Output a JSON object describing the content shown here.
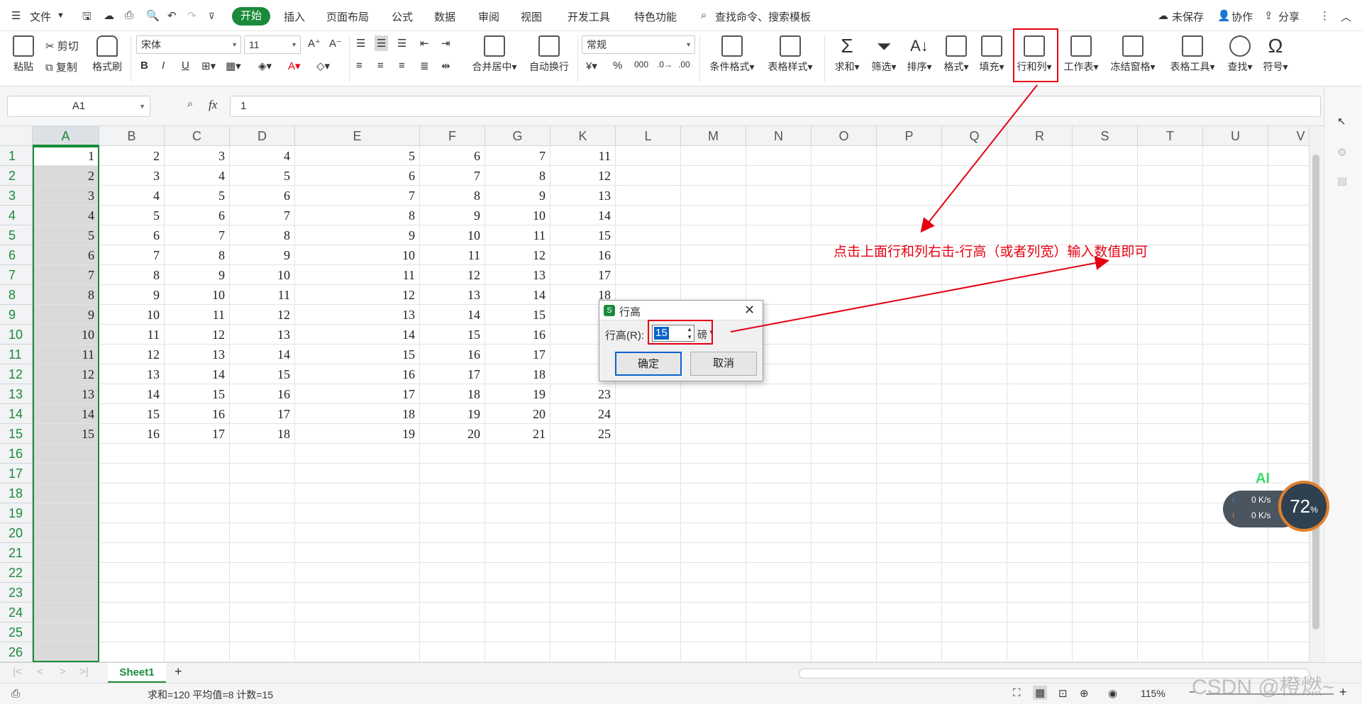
{
  "menubar": {
    "file": "文件",
    "tabs": [
      "开始",
      "插入",
      "页面布局",
      "公式",
      "数据",
      "审阅",
      "视图",
      "开发工具",
      "特色功能"
    ],
    "search": "查找命令、搜索模板",
    "unsaved": "未保存",
    "collab": "协作",
    "share": "分享"
  },
  "toolbar": {
    "paste": "粘贴",
    "cut": "剪切",
    "copy": "复制",
    "format_painter": "格式刷",
    "font_name": "宋体",
    "font_size": "11",
    "merge": "合并居中",
    "wrap": "自动换行",
    "number_format": "常规",
    "cond_format": "条件格式",
    "table_style": "表格样式",
    "sum": "求和",
    "filter": "筛选",
    "sort": "排序",
    "format": "格式",
    "fill": "填充",
    "row_col": "行和列",
    "worksheet": "工作表",
    "freeze": "冻结窗格",
    "table_tools": "表格工具",
    "find": "查找",
    "symbol": "符号"
  },
  "formula": {
    "name_box": "A1",
    "fx": "fx",
    "value": "1"
  },
  "sheet": {
    "columns": [
      "A",
      "B",
      "C",
      "D",
      "E",
      "F",
      "G",
      "K",
      "L",
      "M",
      "N",
      "O",
      "P",
      "Q",
      "R",
      "S",
      "T",
      "U",
      "V"
    ],
    "rows": [
      "1",
      "2",
      "3",
      "4",
      "5",
      "6",
      "7",
      "8",
      "9",
      "10",
      "11",
      "12",
      "13",
      "14",
      "15",
      "16",
      "17",
      "18",
      "19",
      "20",
      "21",
      "22",
      "23",
      "24",
      "25",
      "26"
    ],
    "data": [
      [
        "1",
        "2",
        "3",
        "4",
        "5",
        "6",
        "7",
        "11"
      ],
      [
        "2",
        "3",
        "4",
        "5",
        "6",
        "7",
        "8",
        "12"
      ],
      [
        "3",
        "4",
        "5",
        "6",
        "7",
        "8",
        "9",
        "13"
      ],
      [
        "4",
        "5",
        "6",
        "7",
        "8",
        "9",
        "10",
        "14"
      ],
      [
        "5",
        "6",
        "7",
        "8",
        "9",
        "10",
        "11",
        "15"
      ],
      [
        "6",
        "7",
        "8",
        "9",
        "10",
        "11",
        "12",
        "16"
      ],
      [
        "7",
        "8",
        "9",
        "10",
        "11",
        "12",
        "13",
        "17"
      ],
      [
        "8",
        "9",
        "10",
        "11",
        "12",
        "13",
        "14",
        "18"
      ],
      [
        "9",
        "10",
        "11",
        "12",
        "13",
        "14",
        "15",
        ""
      ],
      [
        "10",
        "11",
        "12",
        "13",
        "14",
        "15",
        "16",
        ""
      ],
      [
        "11",
        "12",
        "13",
        "14",
        "15",
        "16",
        "17",
        ""
      ],
      [
        "12",
        "13",
        "14",
        "15",
        "16",
        "17",
        "18",
        ""
      ],
      [
        "13",
        "14",
        "15",
        "16",
        "17",
        "18",
        "19",
        "23"
      ],
      [
        "14",
        "15",
        "16",
        "17",
        "18",
        "19",
        "20",
        "24"
      ],
      [
        "15",
        "16",
        "17",
        "18",
        "19",
        "20",
        "21",
        "25"
      ]
    ]
  },
  "dialog": {
    "title": "行高",
    "label": "行高(R):",
    "value": "15",
    "unit": "磅",
    "ok": "确定",
    "cancel": "取消"
  },
  "annotation": "点击上面行和列右击-行高（或者列宽）输入数值即可",
  "sheet_tab": "Sheet1",
  "status": {
    "summary": "求和=120  平均值=8  计数=15",
    "zoom": "115%"
  },
  "widget": {
    "ai": "AI",
    "up": "0 K/s",
    "down": "0 K/s",
    "percent": "72"
  },
  "watermark": "CSDN @橙燃~",
  "colors": {
    "accent": "#1a8a3a",
    "annotation": "#e60012"
  }
}
